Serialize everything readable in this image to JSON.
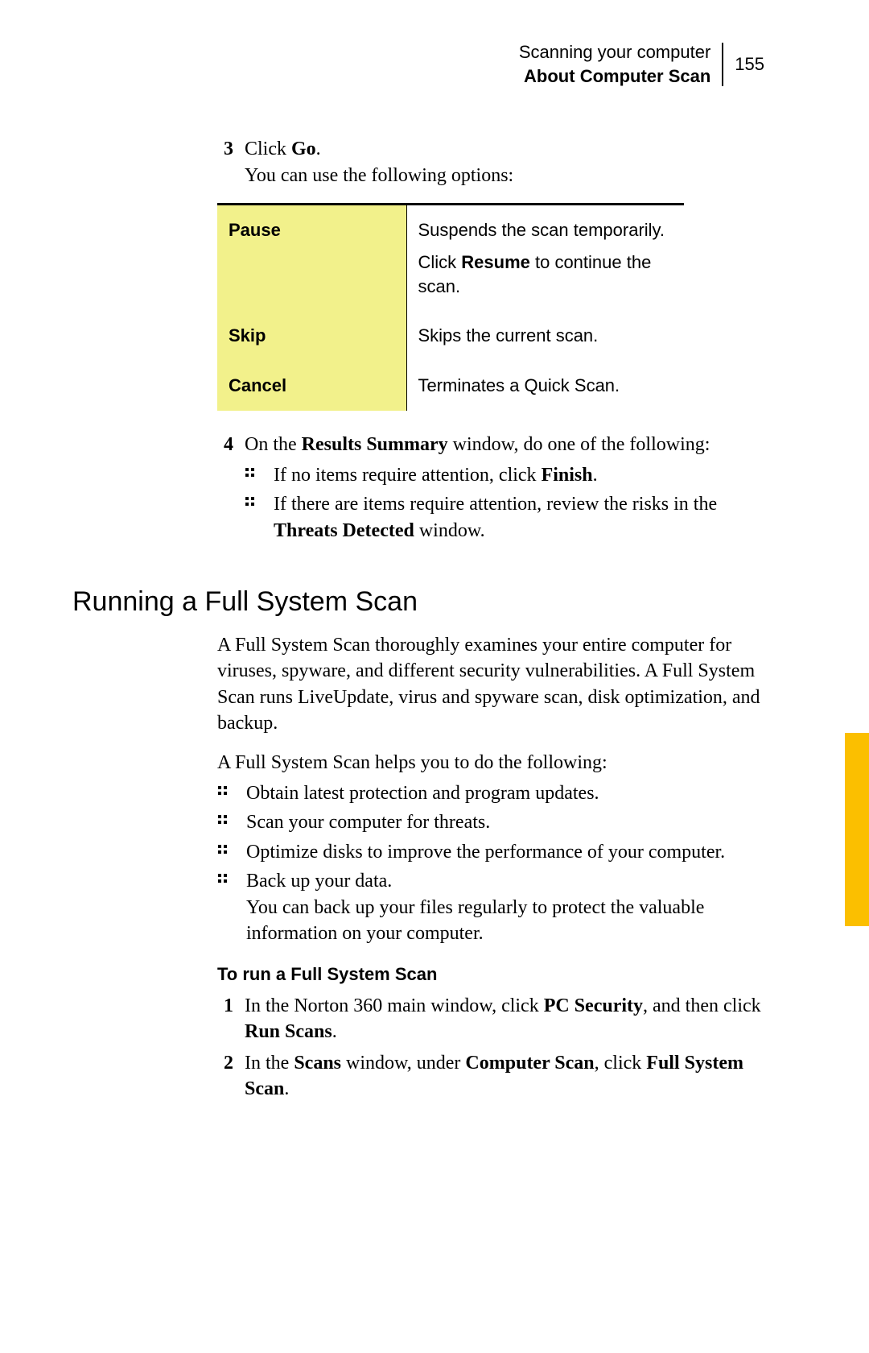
{
  "header": {
    "chapter": "Scanning your computer",
    "section": "About Computer Scan",
    "page_number": "155"
  },
  "step3": {
    "num": "3",
    "line1_pre": "Click ",
    "line1_bold": "Go",
    "line1_post": ".",
    "line2": "You can use the following options:"
  },
  "options": [
    {
      "label": "Pause",
      "desc_p1": "Suspends the scan temporarily.",
      "desc_p2_pre": "Click ",
      "desc_p2_bold": "Resume",
      "desc_p2_post": " to continue the scan."
    },
    {
      "label": "Skip",
      "desc_p1": "Skips the current scan."
    },
    {
      "label": "Cancel",
      "desc_p1": "Terminates a Quick Scan."
    }
  ],
  "step4": {
    "num": "4",
    "line_pre": "On the ",
    "line_b1": "Results Summary",
    "line_post": " window, do one of the following:",
    "bullets": [
      {
        "pre": "If no items require attention, click ",
        "b1": "Finish",
        "post": "."
      },
      {
        "pre": "If there are items require attention, review the risks in the ",
        "b1": "Threats Detected",
        "post": " window."
      }
    ]
  },
  "section_title": "Running a Full System Scan",
  "intro_para": "A Full System Scan thoroughly examines your entire computer for viruses, spyware, and different security vulnerabilities. A Full System Scan runs LiveUpdate, virus and spyware scan, disk optimization, and backup.",
  "helps_para": "A Full System Scan helps you to do the following:",
  "helps_bullets": [
    {
      "text": "Obtain latest protection and program updates."
    },
    {
      "text": "Scan your computer for threats."
    },
    {
      "text": "Optimize disks to improve the performance of your computer."
    },
    {
      "text": "Back up your data.",
      "extra": "You can back up your files regularly to protect the valuable information on your computer."
    }
  ],
  "subhead": "To run a Full System Scan",
  "run_steps": [
    {
      "num": "1",
      "pre": "In the Norton 360 main window, click ",
      "b1": "PC Security",
      "mid": ", and then click ",
      "b2": "Run Scans",
      "post": "."
    },
    {
      "num": "2",
      "pre": "In the ",
      "b1": "Scans",
      "mid": " window, under ",
      "b2": "Computer Scan",
      "mid2": ", click ",
      "b3": "Full System Scan",
      "post": "."
    }
  ]
}
